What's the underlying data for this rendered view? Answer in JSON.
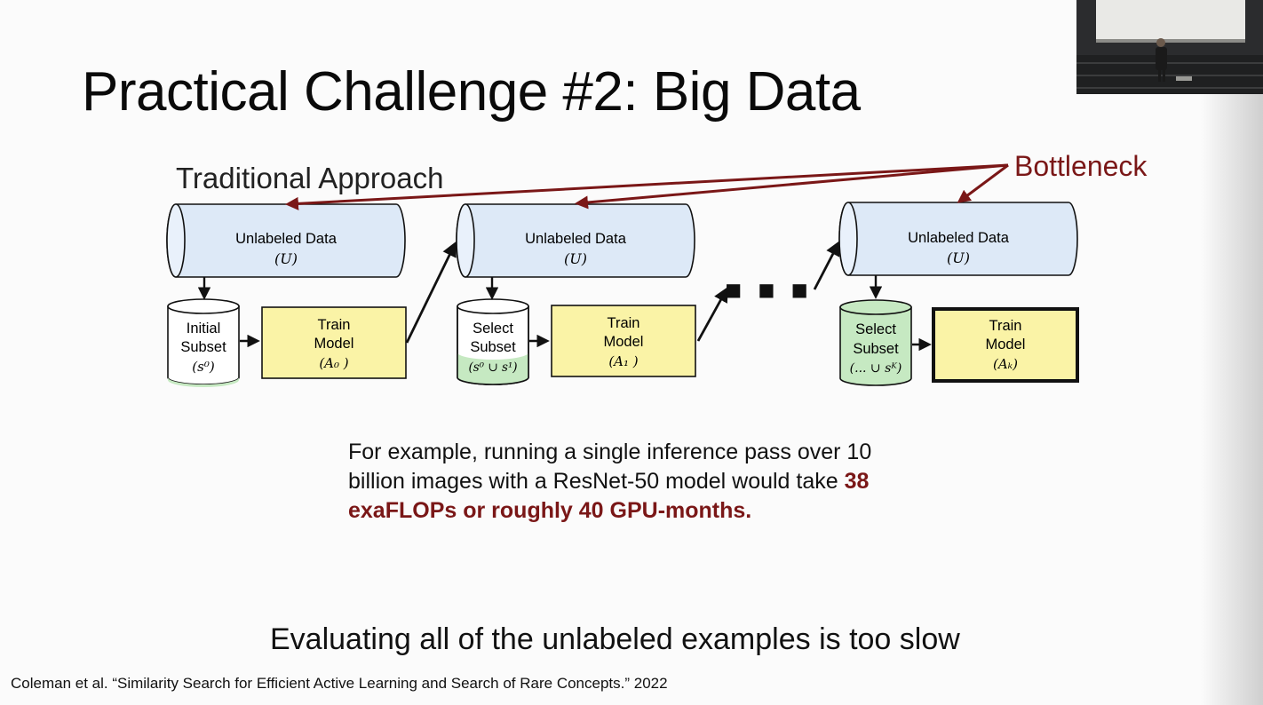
{
  "slide": {
    "title": "Practical Challenge #2: Big Data",
    "diagram_label": "Traditional Approach",
    "bottleneck_label": "Bottleneck",
    "ellipsis": "■ ■ ■",
    "stages": [
      {
        "pool_label": "Unlabeled Data",
        "pool_symbol": "(U)",
        "subset_lines": [
          "Initial",
          "Subset",
          "(s⁰)"
        ],
        "model_lines": [
          "Train",
          "Model",
          "(A₀ )"
        ]
      },
      {
        "pool_label": "Unlabeled Data",
        "pool_symbol": "(U)",
        "subset_lines": [
          "Select",
          "Subset",
          "(s⁰ ∪ s¹)"
        ],
        "model_lines": [
          "Train",
          "Model",
          "(A₁ )"
        ]
      },
      {
        "pool_label": "Unlabeled Data",
        "pool_symbol": "(U)",
        "subset_lines": [
          "Select",
          "Subset",
          "(... ∪ sᴷ)"
        ],
        "model_lines": [
          "Train",
          "Model",
          "(Aₖ)"
        ]
      }
    ],
    "paragraph": {
      "part1": "For example, running a single inference pass over 10 billion images with a ResNet-50 model would take ",
      "highlight": "38 exaFLOPs or roughly 40 GPU-months."
    },
    "conclusion": "Evaluating all of the unlabeled examples is too slow",
    "citation": "Coleman et al. “Similarity Search for Efficient Active Learning and Search of Rare Concepts.” 2022"
  },
  "colors": {
    "pool_fill": "#dde9f7",
    "model_fill": "#faf3a6",
    "subset_green": "#c6e9c2",
    "bottleneck": "#7a1717",
    "stroke": "#111111"
  },
  "video": {
    "icon": "presenter-video-thumbnail"
  }
}
